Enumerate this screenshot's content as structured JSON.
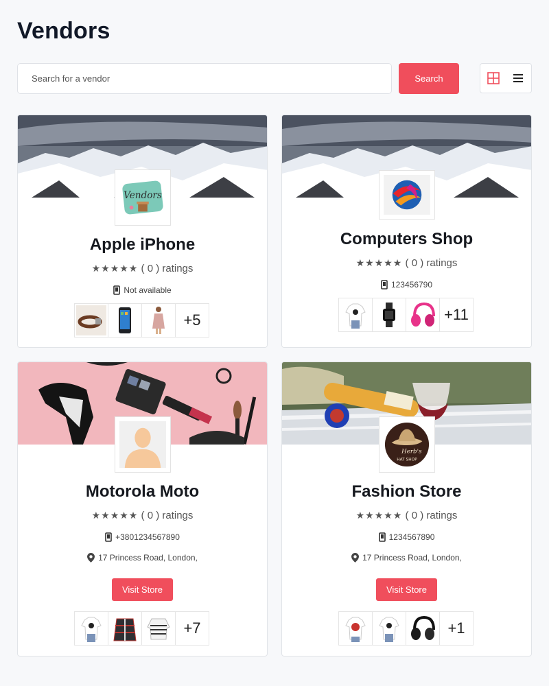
{
  "page": {
    "title": "Vendors"
  },
  "search": {
    "placeholder": "Search for a vendor",
    "button_label": "Search"
  },
  "view_toggle": {
    "grid_icon": "grid-icon",
    "list_icon": "list-icon",
    "active": "grid"
  },
  "vendors": [
    {
      "name": "Apple iPhone",
      "stars": "★★★★★",
      "ratings_text": "( 0 ) ratings",
      "phone": "Not available",
      "address": "",
      "visit_label": "",
      "more_count": "+5",
      "banner": "snowy-mountains",
      "logo": "vendors-logo",
      "thumbnails": [
        "belt",
        "smartphone",
        "dress"
      ]
    },
    {
      "name": "Computers Shop",
      "stars": "★★★★★",
      "ratings_text": "( 0 ) ratings",
      "phone": "123456790",
      "address": "",
      "visit_label": "",
      "more_count": "+11",
      "banner": "snowy-mountains",
      "logo": "swirl-logo",
      "thumbnails": [
        "tshirt",
        "smartwatch",
        "headphones-pink"
      ]
    },
    {
      "name": "Motorola Moto",
      "stars": "★★★★★",
      "ratings_text": "( 0 ) ratings",
      "phone": "+3801234567890",
      "address": "17 Princess Road, London,",
      "visit_label": "Visit Store",
      "more_count": "+7",
      "banner": "cosmetics",
      "logo": "avatar-placeholder",
      "thumbnails": [
        "tshirt",
        "plaid-jacket",
        "striped-sweater"
      ]
    },
    {
      "name": "Fashion Store",
      "stars": "★★★★★",
      "ratings_text": "( 0 ) ratings",
      "phone": "1234567890",
      "address": "17 Princess Road, London,",
      "visit_label": "Visit Store",
      "more_count": "+1",
      "banner": "wine-table",
      "logo": "hat-shop-logo",
      "logo_text_top": "Herb's",
      "logo_text_bottom": "HAT SHOP",
      "thumbnails": [
        "tshirt-print",
        "tshirt",
        "headphones-black"
      ]
    }
  ],
  "colors": {
    "accent": "#f04e5c",
    "text": "#16191f",
    "muted": "#555555",
    "background": "#f7f8fa"
  }
}
